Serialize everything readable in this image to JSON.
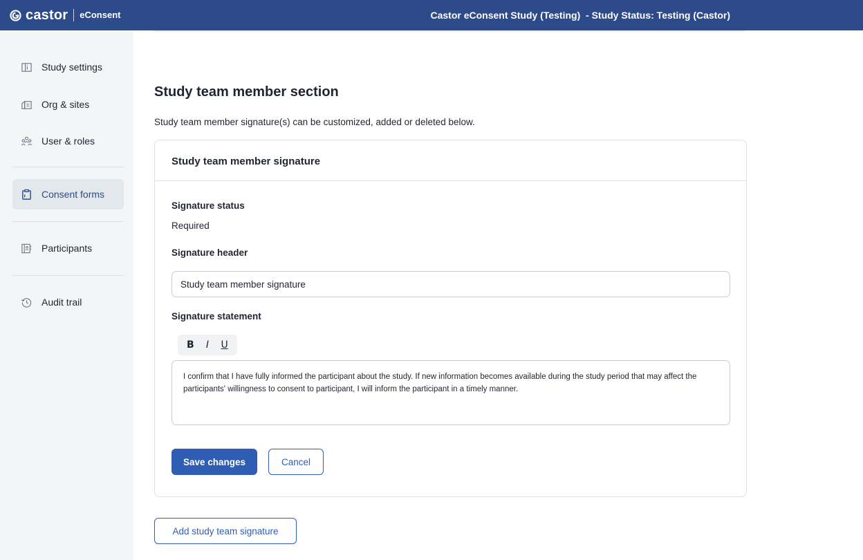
{
  "header": {
    "brand": "castor",
    "product": "eConsent",
    "study_title": "Castor eConsent Study (Testing)  - Study Status: Testing (Castor)",
    "brand_color": "#2d4a8a"
  },
  "sidebar": {
    "items": [
      {
        "label": "Study settings",
        "icon": "study-settings-icon",
        "active": false
      },
      {
        "label": "Org & sites",
        "icon": "building-icon",
        "active": false
      },
      {
        "label": "User & roles",
        "icon": "users-icon",
        "active": false
      },
      {
        "label": "Consent forms",
        "icon": "clipboard-icon",
        "active": true
      },
      {
        "label": "Participants",
        "icon": "participants-icon",
        "active": false
      },
      {
        "label": "Audit trail",
        "icon": "history-icon",
        "active": false
      }
    ]
  },
  "main": {
    "section_title": "Study team member section",
    "section_description": "Study team member signature(s) can be customized, added or deleted below.",
    "card": {
      "title": "Study team member signature",
      "signature_status_label": "Signature status",
      "signature_status_value": "Required",
      "signature_header_label": "Signature header",
      "signature_header_value": "Study team member signature",
      "signature_statement_label": "Signature statement",
      "toolbar": {
        "bold": "B",
        "italic": "I",
        "underline": "U"
      },
      "signature_statement_text": "I confirm that I have fully informed the participant about the study. If new information becomes available during the study period that may affect the participants' willingness to consent to participant, I will inform the participant in a timely manner.",
      "save_label": "Save changes",
      "cancel_label": "Cancel"
    },
    "add_signature_label": "Add study team signature"
  },
  "colors": {
    "primary_button": "#2f5db3",
    "sidebar_bg": "#f2f6f7"
  }
}
